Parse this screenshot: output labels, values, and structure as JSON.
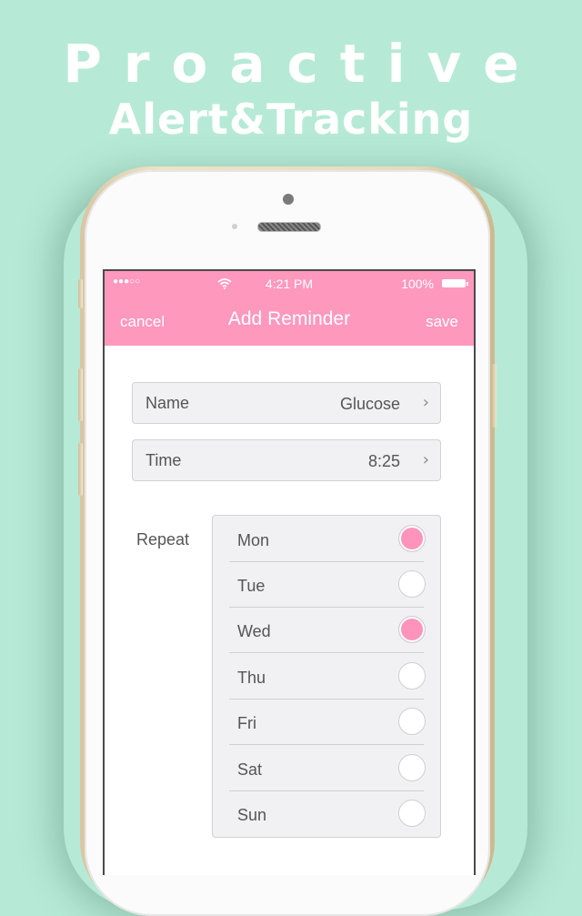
{
  "promo": {
    "headline_line1": "Proactive",
    "headline_line2": "Alert&Tracking",
    "background_color": "#b6ead6"
  },
  "status_bar": {
    "signal": "●●●○○",
    "wifi_icon": "wifi-icon",
    "time": "4:21 PM",
    "battery_percent": "100%",
    "battery_icon": "battery-icon"
  },
  "navbar": {
    "cancel_label": "cancel",
    "title": "Add Reminder",
    "save_label": "save",
    "accent_color": "#ff98bd"
  },
  "form": {
    "name": {
      "label": "Name",
      "value": "Glucose",
      "chevron": "›"
    },
    "time": {
      "label": "Time",
      "value": "8:25",
      "chevron": "›"
    },
    "repeat": {
      "label": "Repeat",
      "days": [
        {
          "label": "Mon",
          "selected": true
        },
        {
          "label": "Tue",
          "selected": false
        },
        {
          "label": "Wed",
          "selected": true
        },
        {
          "label": "Thu",
          "selected": false
        },
        {
          "label": "Fri",
          "selected": false
        },
        {
          "label": "Sat",
          "selected": false
        },
        {
          "label": "Sun",
          "selected": false
        }
      ]
    }
  }
}
